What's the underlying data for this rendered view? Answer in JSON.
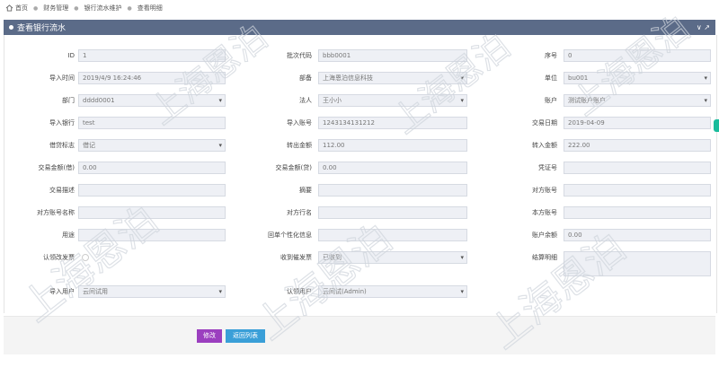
{
  "breadcrumb": [
    "首页",
    "财务管理",
    "银行流水维护",
    "查看明细"
  ],
  "panel": {
    "title": "查看银行流水",
    "tools": "∨ ↗"
  },
  "fields": {
    "id": {
      "label": "ID",
      "value": "1"
    },
    "batch": {
      "label": "批次代码",
      "value": "bbb0001"
    },
    "seq": {
      "label": "序号",
      "value": "0"
    },
    "import_time": {
      "label": "导入时间",
      "value": "2019/4/9 16:24:46"
    },
    "dept": {
      "label": "部备",
      "value": "上海恩泊信息科技"
    },
    "unit": {
      "label": "单位",
      "value": "bu001"
    },
    "division": {
      "label": "部门",
      "value": "dddd0001"
    },
    "legal": {
      "label": "法人",
      "value": "王小小"
    },
    "account": {
      "label": "账户",
      "value": "测试账户账户"
    },
    "import_bank": {
      "label": "导入银行",
      "value": "test"
    },
    "import_acct": {
      "label": "导入账号",
      "value": "1243134131212"
    },
    "trade_date": {
      "label": "交易日期",
      "value": "2019-04-09"
    },
    "dc_flag": {
      "label": "借贷标志",
      "value": "借记"
    },
    "out_amount": {
      "label": "转出金额",
      "value": "112.00"
    },
    "in_amount": {
      "label": "转入金额",
      "value": "222.00"
    },
    "trade_amt_debit": {
      "label": "交易金额(借)",
      "value": "0.00"
    },
    "trade_amt_credit": {
      "label": "交易金额(贷)",
      "value": "0.00"
    },
    "voucher": {
      "label": "凭证号",
      "value": ""
    },
    "trade_desc": {
      "label": "交易描述",
      "value": ""
    },
    "summary": {
      "label": "摘要",
      "value": ""
    },
    "counter_acct": {
      "label": "对方账号",
      "value": ""
    },
    "counter_name": {
      "label": "对方账号名称",
      "value": ""
    },
    "counter_bank": {
      "label": "对方行名",
      "value": ""
    },
    "own_acct": {
      "label": "本方账号",
      "value": ""
    },
    "usage": {
      "label": "用途",
      "value": ""
    },
    "receipt_info": {
      "label": "回单个性化信息",
      "value": ""
    },
    "balance": {
      "label": "账户余额",
      "value": "0.00"
    },
    "claimed": {
      "label": "认领改发票",
      "value": ""
    },
    "received": {
      "label": "收到催发票",
      "value": "已收到"
    },
    "settle_detail": {
      "label": "结算明细",
      "value": ""
    },
    "import_user": {
      "label": "导入用户",
      "value": "云间试用"
    },
    "claim_user": {
      "label": "认领用户",
      "value": "云间试(Admin)"
    }
  },
  "buttons": {
    "edit": "修改",
    "back": "返回列表"
  },
  "watermark": "上海恩泊",
  "colors": {
    "header": "#5b6b88",
    "edit": "#9b3fbf",
    "back": "#3a9fd8"
  }
}
